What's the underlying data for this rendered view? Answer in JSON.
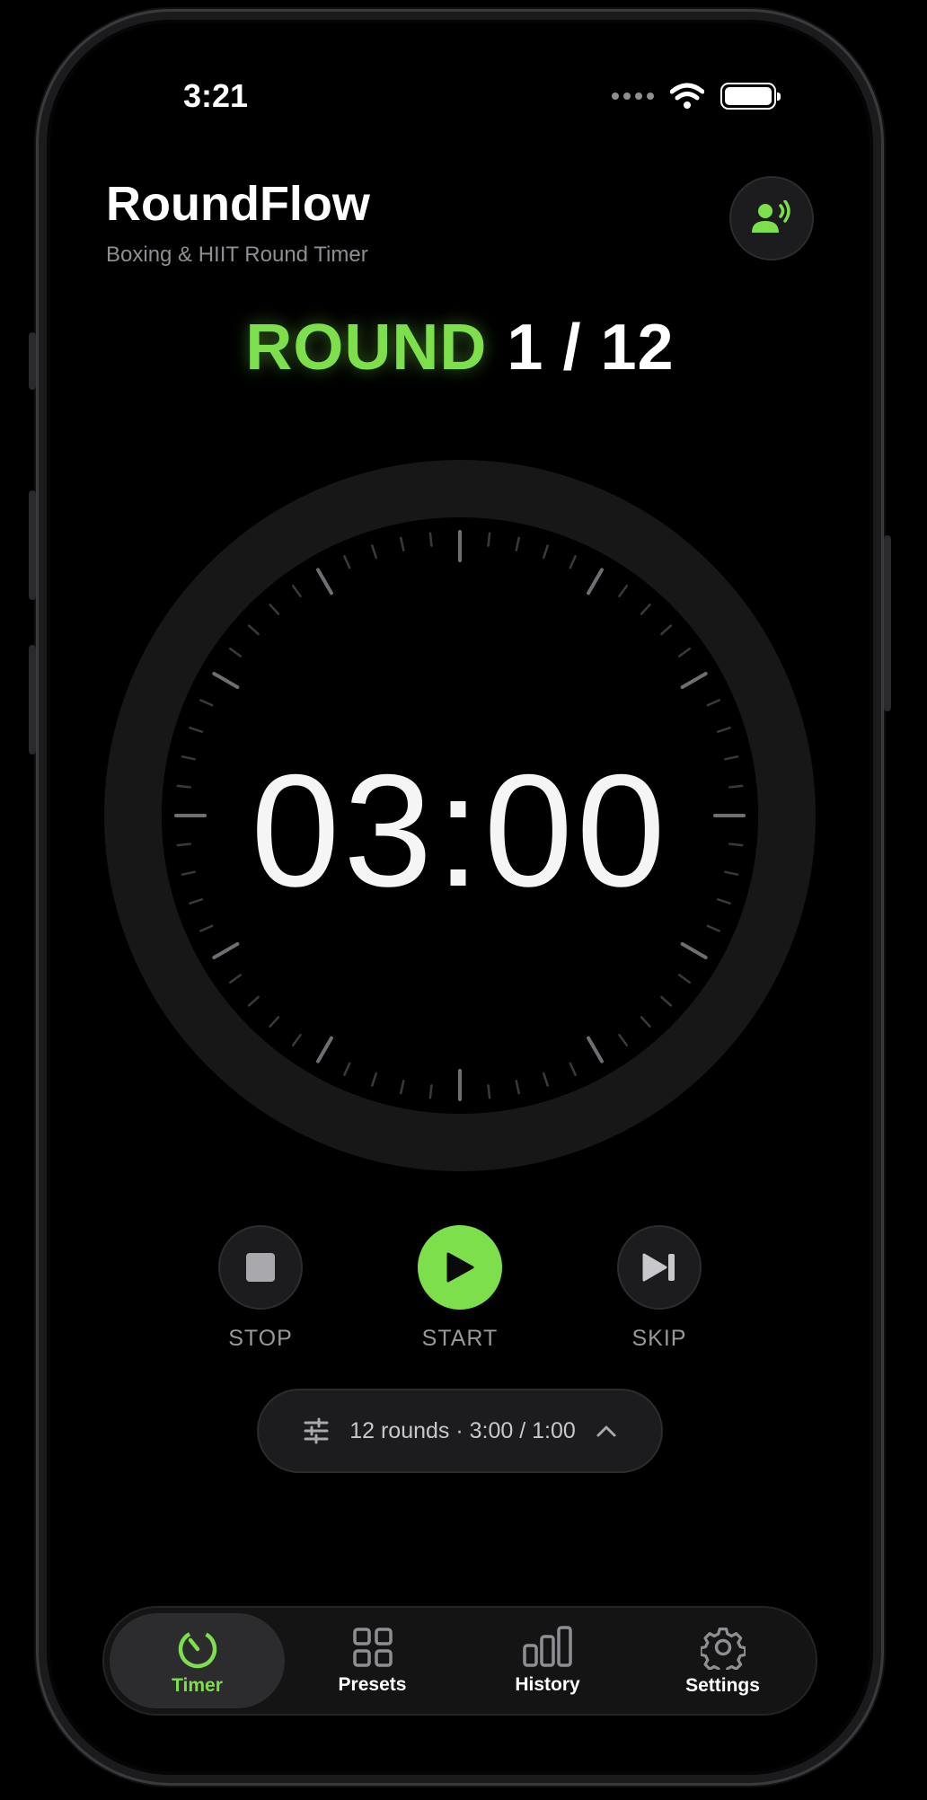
{
  "status_bar": {
    "time": "3:21"
  },
  "header": {
    "title": "RoundFlow",
    "subtitle": "Boxing & HIIT Round Timer"
  },
  "round": {
    "word": "ROUND",
    "count": "1 / 12"
  },
  "timer": {
    "display": "03:00"
  },
  "controls": {
    "stop_label": "STOP",
    "start_label": "START",
    "skip_label": "SKIP"
  },
  "summary": {
    "text": "12 rounds · 3:00 / 1:00"
  },
  "tabs": [
    {
      "label": "Timer",
      "icon": "stopwatch-icon",
      "active": true
    },
    {
      "label": "Presets",
      "icon": "grid-icon",
      "active": false
    },
    {
      "label": "History",
      "icon": "bar-chart-icon",
      "active": false
    },
    {
      "label": "Settings",
      "icon": "gear-icon",
      "active": false
    }
  ],
  "colors": {
    "accent": "#7ddf4c",
    "background": "#000000",
    "surface": "#1c1c1e"
  }
}
